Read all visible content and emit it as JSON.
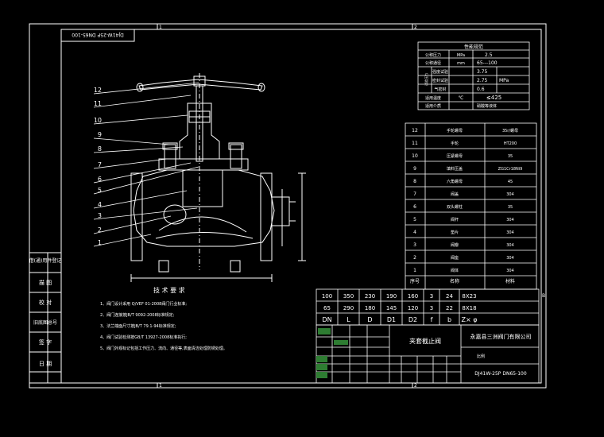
{
  "zone_marks": {
    "top": [
      "1",
      "2"
    ],
    "bottom": [
      "1",
      "2"
    ],
    "right": "B"
  },
  "drawing_code": "DJ41W-25P DN65-100",
  "part_numbers": [
    "12",
    "11",
    "10",
    "9",
    "8",
    "7",
    "6",
    "5",
    "4",
    "3",
    "2",
    "1"
  ],
  "performance": {
    "title": "性能规范",
    "rows": [
      {
        "label": "公称压力",
        "unit": "MPa",
        "value": "2.5"
      },
      {
        "label": "公称通径",
        "unit": "mm",
        "value": "65---100"
      },
      {
        "label": "试验压力",
        "sub": "强度试验",
        "unit": "",
        "value": "3.75"
      },
      {
        "label": "",
        "sub": "密封试验",
        "unit": "MPa",
        "value": "2.75"
      },
      {
        "label": "",
        "sub": "气密封",
        "unit": "",
        "value": "0.6"
      },
      {
        "label": "适用温度",
        "unit": "℃",
        "value": "≤425"
      },
      {
        "label": "适用介质",
        "unit": "",
        "value": "硝酸等液体"
      }
    ]
  },
  "parts": {
    "rows": [
      {
        "no": "12",
        "name": "手轮螺母",
        "material": "35r/螺母"
      },
      {
        "no": "11",
        "name": "手轮",
        "material": "HT200"
      },
      {
        "no": "10",
        "name": "压紧螺母",
        "material": "35"
      },
      {
        "no": "9",
        "name": "填料压盖",
        "material": "ZG1Cr18Ni9"
      },
      {
        "no": "8",
        "name": "六角螺母",
        "material": "45"
      },
      {
        "no": "7",
        "name": "阀盖",
        "material": "304"
      },
      {
        "no": "6",
        "name": "双头螺柱",
        "material": "35"
      },
      {
        "no": "5",
        "name": "阀杆",
        "material": "304"
      },
      {
        "no": "4",
        "name": "垫片",
        "material": "304"
      },
      {
        "no": "3",
        "name": "阀瓣",
        "material": "304"
      },
      {
        "no": "2",
        "name": "阀座",
        "material": "304"
      },
      {
        "no": "1",
        "name": "阀体",
        "material": "304"
      }
    ],
    "header": {
      "no": "序号",
      "name": "名称",
      "material": "材料"
    }
  },
  "dimensions": {
    "row_a": [
      "100",
      "350",
      "230",
      "190",
      "160",
      "3",
      "24",
      "8X23"
    ],
    "row_b": [
      "65",
      "290",
      "180",
      "145",
      "120",
      "3",
      "22",
      "8X18"
    ],
    "headers": [
      "DN",
      "L",
      "D",
      "D1",
      "D2",
      "f",
      "b",
      "Z× φ"
    ]
  },
  "tech_req": {
    "title": "技 术 要 求",
    "items": [
      "1、阀门设计采用 Q/VEF 01-2008阀门行业标准;",
      "2、阀门连接按JB/T 9092-2008标准规定;",
      "3、法兰端面尺寸按JB/T 79.1-94标准规定;",
      "4、阀门试验检测按GB/T 13927-2008标准执行;",
      "5、阀门外观标记包括工作压力、流向、通径等,表面清洁处理防锈处理。"
    ]
  },
  "title_block": {
    "name": "夹套截止阀",
    "company": "永嘉县三洲阀门有限公司",
    "scale_label": "比例"
  },
  "left_strip": [
    "借(通)用件登记",
    "描 图",
    "校 对",
    "旧底图总号",
    "签 字",
    "日 期"
  ],
  "header_box": "DJ41W-25P DN65-100",
  "colors": {
    "line": "#ffffff",
    "valve": "#ffffff",
    "leader": "#ffffff"
  }
}
